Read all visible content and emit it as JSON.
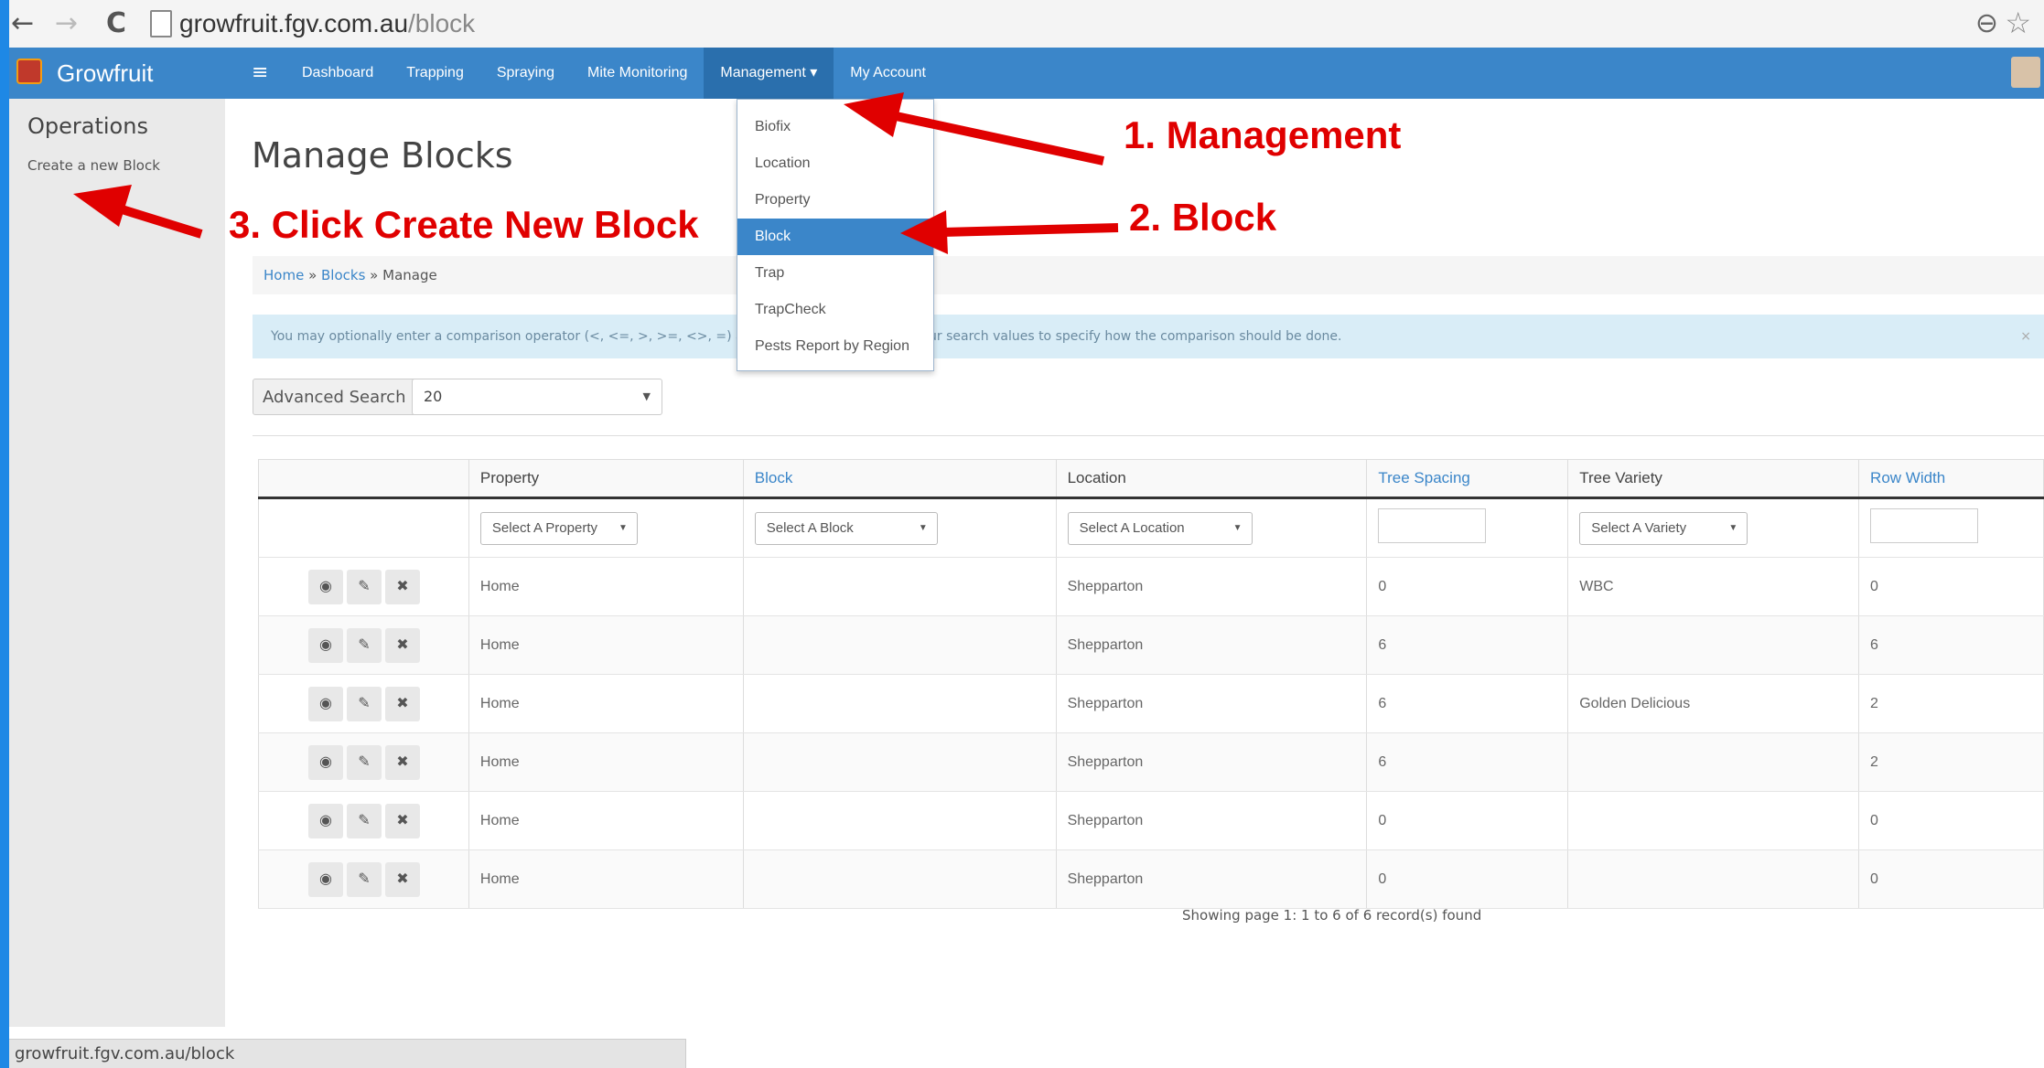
{
  "browser": {
    "back_icon": "←",
    "forward_icon": "→",
    "reload_icon": "C",
    "url_domain": "growfruit.fgv.com.au",
    "url_path": "/block",
    "zoom_icon": "⊖",
    "star_icon": "☆"
  },
  "navbar": {
    "brand": "Growfruit",
    "menu_icon": "≡",
    "items": [
      {
        "label": "Dashboard"
      },
      {
        "label": "Trapping"
      },
      {
        "label": "Spraying"
      },
      {
        "label": "Mite Monitoring"
      },
      {
        "label": "Management ▾"
      },
      {
        "label": "My Account"
      }
    ]
  },
  "management_menu": {
    "items": [
      {
        "label": "Biofix"
      },
      {
        "label": "Location"
      },
      {
        "label": "Property"
      },
      {
        "label": "Block"
      },
      {
        "label": "Trap"
      },
      {
        "label": "TrapCheck"
      },
      {
        "label": "Pests Report by Region"
      }
    ],
    "active": "Block"
  },
  "sidebar": {
    "title": "Operations",
    "link": "Create a new Block"
  },
  "page": {
    "title": "Manage Blocks",
    "breadcrumb": {
      "home": "Home",
      "sep1": " » ",
      "blocks": "Blocks",
      "sep2": " » ",
      "current": "Manage"
    },
    "alert_text": "You may optionally enter a comparison operator (<, <=, >, >=, <>, =) at the beginning of each of your search values to specify how the comparison should be done.",
    "alert_close": "×",
    "advanced_search": "Advanced Search",
    "page_size": "20",
    "pager": "Showing page 1: 1 to 6 of 6 record(s) found"
  },
  "table": {
    "headers": [
      {
        "label": "",
        "sort": false
      },
      {
        "label": "Property",
        "sort": false
      },
      {
        "label": "Block",
        "sort": true
      },
      {
        "label": "Location",
        "sort": false
      },
      {
        "label": "Tree Spacing",
        "sort": true
      },
      {
        "label": "Tree Variety",
        "sort": false
      },
      {
        "label": "Row Width",
        "sort": true
      }
    ],
    "filters": {
      "property": "Select A Property",
      "block": "Select A Block",
      "location": "Select A Location",
      "variety": "Select A Variety",
      "arrow": "▼"
    },
    "action_icons": {
      "view": "◉",
      "edit": "✎",
      "delete": "✖"
    },
    "rows": [
      {
        "property": "Home",
        "block": "",
        "location": "Shepparton",
        "spacing": "0",
        "variety": "WBC",
        "row_width": "0"
      },
      {
        "property": "Home",
        "block": "",
        "location": "Shepparton",
        "spacing": "6",
        "variety": "",
        "row_width": "6"
      },
      {
        "property": "Home",
        "block": "",
        "location": "Shepparton",
        "spacing": "6",
        "variety": "Golden Delicious",
        "row_width": "2"
      },
      {
        "property": "Home",
        "block": "",
        "location": "Shepparton",
        "spacing": "6",
        "variety": "",
        "row_width": "2"
      },
      {
        "property": "Home",
        "block": "",
        "location": "Shepparton",
        "spacing": "0",
        "variety": "",
        "row_width": "0"
      },
      {
        "property": "Home",
        "block": "",
        "location": "Shepparton",
        "spacing": "0",
        "variety": "",
        "row_width": "0"
      }
    ]
  },
  "status_bar": "growfruit.fgv.com.au/block",
  "annotations": {
    "step1": "1. Management",
    "step2": "2. Block",
    "step3": "3. Click Create New Block",
    "color": "#e00000"
  }
}
